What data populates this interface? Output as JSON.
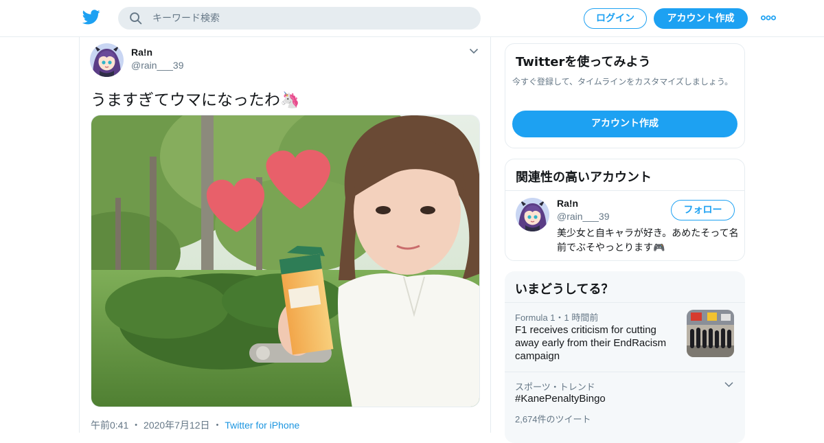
{
  "header": {
    "search_placeholder": "キーワード検索",
    "login_label": "ログイン",
    "signup_label": "アカウント作成",
    "icons": [
      "twitter-bird-icon",
      "search-icon",
      "more-icon"
    ],
    "brand_color": "#1da1f2"
  },
  "tweet": {
    "author_name": "Ra!n",
    "author_handle": "@rain___39",
    "text": "うますぎてウマになったわ🦄",
    "time": "午前0:41",
    "date": "2020年7月12日",
    "source": "Twitter for iPhone"
  },
  "sidebar": {
    "try": {
      "title": "Twitterを使ってみよう",
      "subtitle": "今すぐ登録して、タイムラインをカスタマイズしましょう。",
      "button": "アカウント作成"
    },
    "related": {
      "title": "関連性の高いアカウント",
      "name": "Ra!n",
      "handle": "@rain___39",
      "follow_label": "フォロー",
      "bio": "美少女と自キャラが好き。あめたそって名前でぶそやっとります🎮"
    },
    "trends": {
      "title": "いまどうしてる？",
      "items": [
        {
          "meta": "Formula 1・1 時間前",
          "text": "F1 receives criticism for cutting away early from their EndRacism campaign"
        },
        {
          "meta": "スポーツ・トレンド",
          "text": "#KanePenaltyBingo",
          "count": "2,674件のツイート"
        }
      ]
    }
  }
}
